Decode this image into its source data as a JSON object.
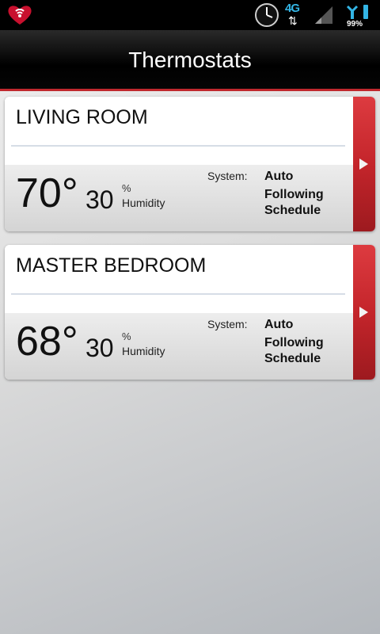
{
  "status_bar": {
    "network": "4G",
    "battery": "99%"
  },
  "header": {
    "title": "Thermostats"
  },
  "thermostats": [
    {
      "name": "LIVING ROOM",
      "temperature": "70°",
      "humidity": "30",
      "humidity_unit": "%",
      "humidity_label": "Humidity",
      "system_label": "System:",
      "system_mode": "Auto",
      "schedule": "Following Schedule"
    },
    {
      "name": "MASTER BEDROOM",
      "temperature": "68°",
      "humidity": "30",
      "humidity_unit": "%",
      "humidity_label": "Humidity",
      "system_label": "System:",
      "system_mode": "Auto",
      "schedule": "Following Schedule"
    }
  ],
  "colors": {
    "accent": "#c0282d",
    "network_blue": "#33b5e5"
  },
  "icons": [
    "iheart-icon",
    "clock-icon",
    "signal-icon",
    "battery-icon",
    "chevron-right-icon"
  ]
}
